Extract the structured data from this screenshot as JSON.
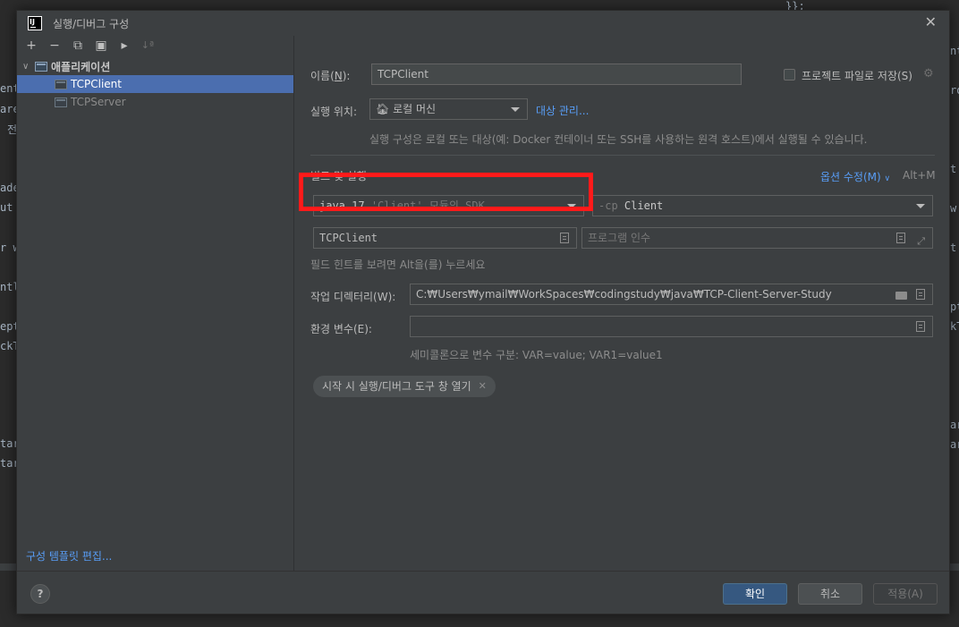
{
  "background": {
    "fragments": [
      "ent",
      "are",
      "전",
      "ade",
      "ut",
      "r w",
      "ntl",
      "ept",
      "ckT",
      "tar",
      "tar",
      "}};",
      "nt",
      "ro",
      "t",
      "t",
      "pt",
      "kT",
      "ar",
      "ar",
      "w"
    ]
  },
  "dialog": {
    "title": "실행/디버그 구성"
  },
  "left": {
    "toolbar": [
      "+",
      "−",
      "⧉",
      "▣",
      "▸",
      "↓ª"
    ],
    "group": "애플리케이션",
    "items": [
      "TCPClient",
      "TCPServer"
    ],
    "selected": "TCPClient",
    "edit_templates": "구성 템플릿 편집..."
  },
  "form": {
    "name_label_prefix": "이름(",
    "name_label_mnemonic": "N",
    "name_label_suffix": "):",
    "name_value": "TCPClient",
    "store_as_project_label": "프로젝트 파일로 저장(S)",
    "run_on_label": "실행 위치:",
    "run_on_value": "로컬 머신",
    "manage_targets_link": "대상 관리...",
    "run_on_hint": "실행 구성은 로컬 또는 대상(예: Docker 컨테이너 또는 SSH를 사용하는 원격 호스트)에서 실행될 수 있습니다.",
    "build_run_title": "빌드 및 실행",
    "modify_options_link": "옵션 수정(M)",
    "modify_options_shortcut": "Alt+M",
    "jdk_main": "java 17",
    "jdk_detail": "'Client' 모듈의 SDK",
    "cp_prefix": "-cp",
    "cp_value": "Client",
    "main_class": "TCPClient",
    "program_args_placeholder": "프로그램 인수",
    "field_hint": "필드 힌트를 보려면 Alt을(를) 누르세요",
    "workdir_label": "작업 디렉터리(W):",
    "workdir_value": "C:₩Users₩ymail₩WorkSpaces₩codingstudy₩java₩TCP-Client-Server-Study",
    "env_label": "환경 변수(E):",
    "env_value": "",
    "env_hint": "세미콜론으로 변수 구분: VAR=value; VAR1=value1",
    "chip_label": "시작 시 실행/디버그 도구 창 열기"
  },
  "buttons": {
    "help": "?",
    "ok": "확인",
    "cancel": "취소",
    "apply": "적용(A)"
  },
  "colors": {
    "highlight_box": "#ff1a1a",
    "selection": "#4b6eaf",
    "link": "#589df6",
    "primary_button": "#365880"
  }
}
